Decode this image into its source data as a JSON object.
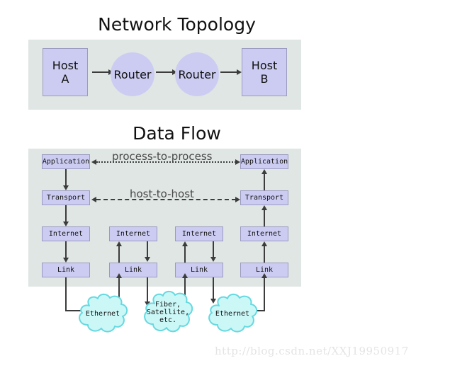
{
  "page": {
    "background": "#ffffff",
    "watermark": "http://blog.csdn.net/XXJ19950917"
  },
  "colors": {
    "panel_bg": "#dfe6e4",
    "node_fill": "#ccccf2",
    "node_border": "#9b9bc0",
    "cloud_fill": "#ccf7f7",
    "cloud_border": "#66d9e0",
    "arrow": "#3c3c3c",
    "title_text": "#111111",
    "flow_label_text": "#4a4a4a",
    "watermark_text": "#e4e4e4"
  },
  "topology": {
    "title": "Network Topology",
    "nodes": [
      {
        "id": "host-a",
        "label": "Host\nA",
        "shape": "rect"
      },
      {
        "id": "router-1",
        "label": "Router",
        "shape": "circle"
      },
      {
        "id": "router-2",
        "label": "Router",
        "shape": "circle"
      },
      {
        "id": "host-b",
        "label": "Host\nB",
        "shape": "rect"
      }
    ],
    "link_direction": "right"
  },
  "dataflow": {
    "title": "Data Flow",
    "columns": [
      {
        "id": "host-a-stack",
        "layers": [
          {
            "id": "application",
            "label": "Application"
          },
          {
            "id": "transport",
            "label": "Transport"
          },
          {
            "id": "internet",
            "label": "Internet"
          },
          {
            "id": "link",
            "label": "Link"
          }
        ]
      },
      {
        "id": "router-1-stack",
        "layers": [
          {
            "id": "internet",
            "label": "Internet"
          },
          {
            "id": "link",
            "label": "Link"
          }
        ]
      },
      {
        "id": "router-2-stack",
        "layers": [
          {
            "id": "internet",
            "label": "Internet"
          },
          {
            "id": "link",
            "label": "Link"
          }
        ]
      },
      {
        "id": "host-b-stack",
        "layers": [
          {
            "id": "application",
            "label": "Application"
          },
          {
            "id": "transport",
            "label": "Transport"
          },
          {
            "id": "internet",
            "label": "Internet"
          },
          {
            "id": "link",
            "label": "Link"
          }
        ]
      }
    ],
    "logical_links": [
      {
        "id": "process-to-process",
        "label": "process-to-process",
        "style": "dotted",
        "direction": "bidirectional"
      },
      {
        "id": "host-to-host",
        "label": "host-to-host",
        "style": "dashed",
        "direction": "bidirectional"
      }
    ],
    "media": [
      {
        "id": "ethernet-left",
        "label": "Ethernet"
      },
      {
        "id": "fiber-satellite",
        "label": "Fiber,\nSatellite,\netc."
      },
      {
        "id": "ethernet-right",
        "label": "Ethernet"
      }
    ]
  }
}
